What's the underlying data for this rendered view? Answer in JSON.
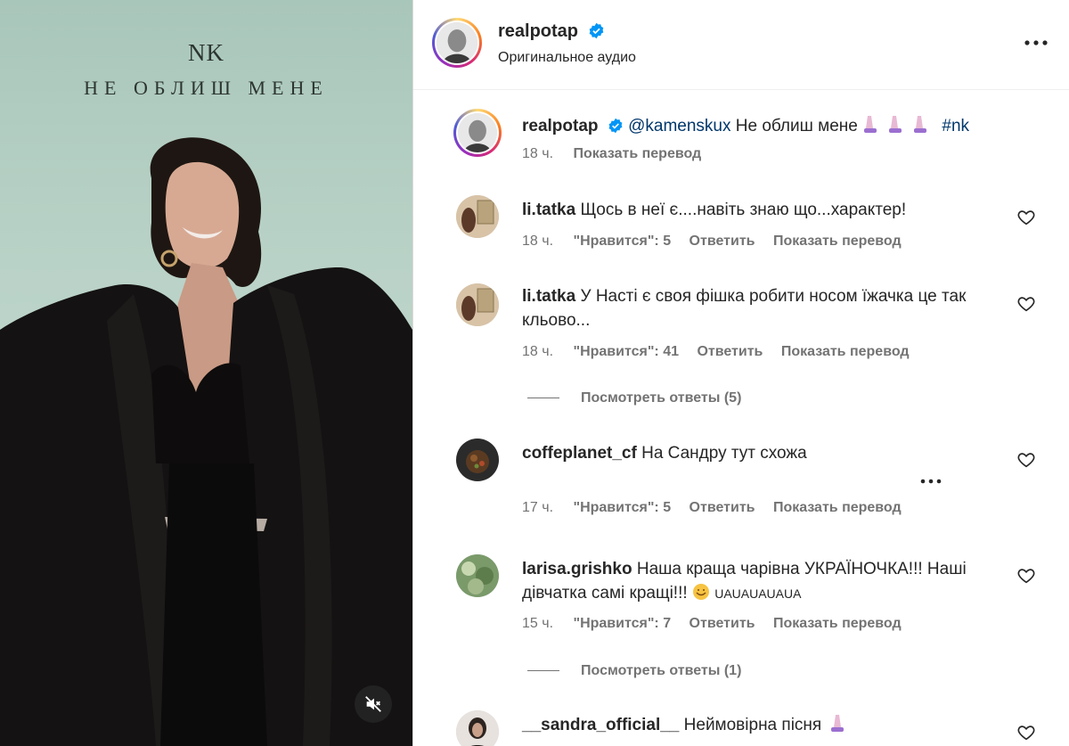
{
  "video": {
    "brand": "NK",
    "title": "НЕ ОБЛИШ МЕНЕ",
    "mute_icon": "speaker-muted-icon"
  },
  "header": {
    "username": "realpotap",
    "audio": "Оригинальное аудио",
    "more_icon": "more-horizontal-icon"
  },
  "caption": {
    "username": "realpotap",
    "mention": "@kamenskux",
    "text": "Не облиш мене",
    "hashtag": "#nk",
    "time": "18 ч.",
    "translate": "Показать перевод"
  },
  "comments": [
    {
      "username": "li.tatka",
      "text": "Щось в неї є....навіть знаю що...характер!",
      "time": "18 ч.",
      "likes": "\"Нравится\": 5",
      "reply": "Ответить",
      "translate": "Показать перевод"
    },
    {
      "username": "li.tatka",
      "text": "У Насті є своя фішка робити носом їжачка це так кльово...",
      "time": "18 ч.",
      "likes": "\"Нравится\": 41",
      "reply": "Ответить",
      "translate": "Показать перевод",
      "view_replies": "Посмотреть ответы (5)"
    },
    {
      "username": "coffeplanet_cf",
      "text": "На Сандру тут схожа",
      "time": "17 ч.",
      "likes": "\"Нравится\": 5",
      "reply": "Ответить",
      "translate": "Показать перевод"
    },
    {
      "username": "larisa.grishko",
      "text": "Наша краща чарівна УКРАЇНОЧКА!!! Наші дівчатка самі кращі!!!",
      "text_tail": "UAUAUAUAUA",
      "time": "15 ч.",
      "likes": "\"Нравится\": 7",
      "reply": "Ответить",
      "translate": "Показать перевод",
      "view_replies": "Посмотреть ответы (1)"
    },
    {
      "username": "__sandra_official__",
      "text": "Неймовірна пісня"
    }
  ],
  "colors": {
    "text": "#262626",
    "secondary": "#737373",
    "link": "#00376b",
    "verified": "#0095f6"
  }
}
